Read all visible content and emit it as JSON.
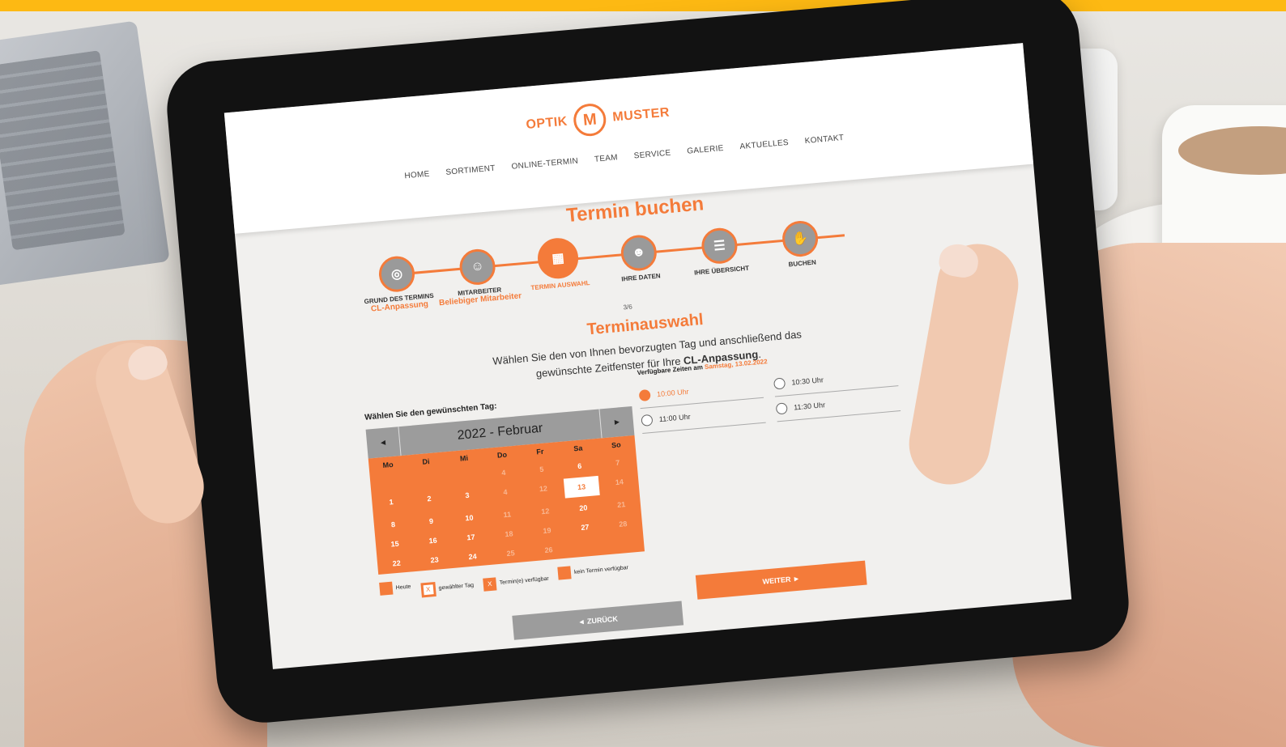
{
  "colors": {
    "accent": "#F47B3A",
    "topbar": "#FDB913",
    "grey": "#9c9c9c"
  },
  "logo": {
    "left": "OPTIK",
    "mark": "M",
    "right": "MUSTER"
  },
  "nav": [
    "HOME",
    "SORTIMENT",
    "ONLINE-TERMIN",
    "TEAM",
    "SERVICE",
    "GALERIE",
    "AKTUELLES",
    "KONTAKT"
  ],
  "page_title": "Termin buchen",
  "steps": [
    {
      "label": "GRUND DES TERMINS",
      "sub": "CL-Anpassung",
      "icon": "glasses-icon"
    },
    {
      "label": "MITARBEITER",
      "sub": "Beliebiger Mitarbeiter",
      "icon": "person-icon"
    },
    {
      "label": "TERMIN AUSWAHL",
      "sub": "",
      "icon": "calendar-icon"
    },
    {
      "label": "IHRE DATEN",
      "sub": "",
      "icon": "user-icon"
    },
    {
      "label": "IHRE ÜBERSICHT",
      "sub": "",
      "icon": "checklist-icon"
    },
    {
      "label": "BUCHEN",
      "sub": "",
      "icon": "handshake-icon"
    }
  ],
  "step_count": "3/6",
  "section_title": "Terminauswahl",
  "intro": {
    "text": "Wählen Sie den von Ihnen bevorzugten Tag und anschließend das gewünschte Zeitfenster für Ihre ",
    "strong": "CL-Anpassung",
    "end": "."
  },
  "calendar": {
    "label": "Wählen Sie den gewünschten Tag:",
    "prev": "◄",
    "next": "►",
    "month": "2022 - Februar",
    "weekdays": [
      "Mo",
      "Di",
      "Mi",
      "Do",
      "Fr",
      "Sa",
      "So"
    ],
    "days": [
      {
        "n": "",
        "off": true
      },
      {
        "n": "",
        "off": true
      },
      {
        "n": "",
        "off": true
      },
      {
        "n": "4",
        "off": true
      },
      {
        "n": "5",
        "off": true
      },
      {
        "n": "6",
        "off": false
      },
      {
        "n": "7",
        "off": true
      },
      {
        "n": "1",
        "off": false
      },
      {
        "n": "2",
        "off": false
      },
      {
        "n": "3",
        "off": false
      },
      {
        "n": "4",
        "off": true
      },
      {
        "n": "12",
        "off": true
      },
      {
        "n": "13",
        "sel": true
      },
      {
        "n": "14",
        "off": true
      },
      {
        "n": "8",
        "off": false
      },
      {
        "n": "9",
        "off": false
      },
      {
        "n": "10",
        "off": false
      },
      {
        "n": "11",
        "off": true
      },
      {
        "n": "12",
        "off": true
      },
      {
        "n": "20",
        "off": false
      },
      {
        "n": "21",
        "off": true
      },
      {
        "n": "15",
        "off": false
      },
      {
        "n": "16",
        "off": false
      },
      {
        "n": "17",
        "off": false
      },
      {
        "n": "18",
        "off": true
      },
      {
        "n": "19",
        "off": true
      },
      {
        "n": "27",
        "off": false
      },
      {
        "n": "28",
        "off": true
      },
      {
        "n": "22",
        "off": false
      },
      {
        "n": "23",
        "off": false
      },
      {
        "n": "24",
        "off": false
      },
      {
        "n": "25",
        "off": true
      },
      {
        "n": "26",
        "off": true
      },
      {
        "n": "",
        "off": true
      },
      {
        "n": "",
        "off": true
      }
    ]
  },
  "legend": [
    {
      "box": "",
      "text": "Heute",
      "type": "today"
    },
    {
      "box": "X",
      "text": "gewählter Tag",
      "type": "sel"
    },
    {
      "box": "X",
      "text": "Termin(e) verfügbar",
      "type": "avail"
    },
    {
      "box": "",
      "text": "kein Termin verfügbar",
      "type": "none"
    }
  ],
  "times": {
    "label": "Verfügbare Zeiten am ",
    "date": "Samstag, 13.02.2022",
    "slots": [
      {
        "time": "10:00 Uhr",
        "selected": true
      },
      {
        "time": "10:30 Uhr",
        "selected": false
      },
      {
        "time": "11:00 Uhr",
        "selected": false
      },
      {
        "time": "11:30 Uhr",
        "selected": false
      }
    ]
  },
  "buttons": {
    "back": "◄ ZURÜCK",
    "next": "WEITER ►"
  }
}
